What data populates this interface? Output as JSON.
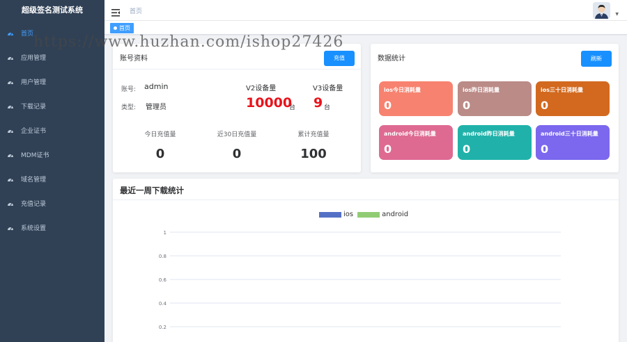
{
  "app": {
    "title": "超级签名测试系统"
  },
  "sidebar": {
    "items": [
      {
        "label": "首页",
        "icon": "dashboard-icon",
        "active": true
      },
      {
        "label": "应用管理",
        "icon": "dashboard-icon"
      },
      {
        "label": "用户管理",
        "icon": "dashboard-icon"
      },
      {
        "label": "下载记录",
        "icon": "dashboard-icon"
      },
      {
        "label": "企业证书",
        "icon": "dashboard-icon"
      },
      {
        "label": "MDM证书",
        "icon": "dashboard-icon"
      },
      {
        "label": "域名管理",
        "icon": "dashboard-icon"
      },
      {
        "label": "充值记录",
        "icon": "dashboard-icon"
      },
      {
        "label": "系统设置",
        "icon": "dashboard-icon"
      }
    ]
  },
  "header": {
    "breadcrumb": "首页",
    "hamburger_icon": "hamburger-icon",
    "avatar_icon": "user-avatar-icon"
  },
  "tags": {
    "active": "首页"
  },
  "watermark": "https://www.huzhan.com/ishop27426",
  "account": {
    "title": "账号资料",
    "recharge_button": "充值",
    "account_label": "账号:",
    "account_value": "admin",
    "type_label": "类型:",
    "type_value": "管理员",
    "v2_label": "V2设备量",
    "v2_value": "10000",
    "v2_unit": "台",
    "v3_label": "V3设备量",
    "v3_value": "9",
    "v3_unit": "台",
    "stats": [
      {
        "label": "今日充值量",
        "value": "0"
      },
      {
        "label": "近30日充值量",
        "value": "0"
      },
      {
        "label": "累计充值量",
        "value": "100"
      }
    ]
  },
  "stats": {
    "title": "数据统计",
    "refresh_button": "刷新",
    "tiles": [
      {
        "label": "ios今日消耗量",
        "value": "0",
        "color": "#f7826f"
      },
      {
        "label": "ios昨日消耗量",
        "value": "0",
        "color": "#bb8b87"
      },
      {
        "label": "ios三十日消耗量",
        "value": "0",
        "color": "#d2691e"
      },
      {
        "label": "android今日消耗量",
        "value": "0",
        "color": "#de6a92"
      },
      {
        "label": "android昨日消耗量",
        "value": "0",
        "color": "#20b2aa"
      },
      {
        "label": "android三十日消耗量",
        "value": "0",
        "color": "#7b68ee"
      }
    ]
  },
  "chart": {
    "title": "最近一周下载统计"
  },
  "chart_data": {
    "type": "bar",
    "series": [
      {
        "name": "ios",
        "color": "#5470c6",
        "values": []
      },
      {
        "name": "android",
        "color": "#91cc75",
        "values": []
      }
    ],
    "y_ticks": [
      "1",
      "0.8",
      "0.6",
      "0.4",
      "0.2"
    ],
    "ylim": [
      0,
      1
    ],
    "grid": true,
    "legend": "top-center"
  },
  "colors": {
    "sidebar_bg": "#304156",
    "accent": "#409eff",
    "button": "#1890ff",
    "danger": "#e8131b"
  }
}
